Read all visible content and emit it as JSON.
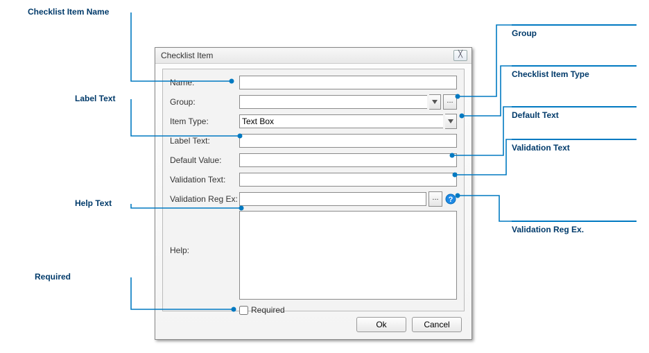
{
  "dialog": {
    "title": "Checklist Item",
    "labels": {
      "name": "Name:",
      "group": "Group:",
      "item_type": "Item Type:",
      "label_text": "Label Text:",
      "default_value": "Default Value:",
      "validation_text": "Validation Text:",
      "validation_regex": "Validation Reg Ex:",
      "help": "Help:",
      "required": "Required"
    },
    "values": {
      "name": "",
      "group": "",
      "item_type": "Text Box",
      "label_text": "",
      "default_value": "",
      "validation_text": "",
      "validation_regex": "",
      "help": "",
      "required": false
    },
    "buttons": {
      "ok": "Ok",
      "cancel": "Cancel"
    },
    "ellipsis": "..."
  },
  "callouts": {
    "checklist_item_name": "Checklist Item Name",
    "label_text": "Label Text",
    "help_text": "Help Text",
    "required": "Required",
    "group": "Group",
    "checklist_item_type": "Checklist Item Type",
    "default_text": "Default Text",
    "validation_text": "Validation Text",
    "validation_reg_ex": "Validation Reg Ex."
  }
}
